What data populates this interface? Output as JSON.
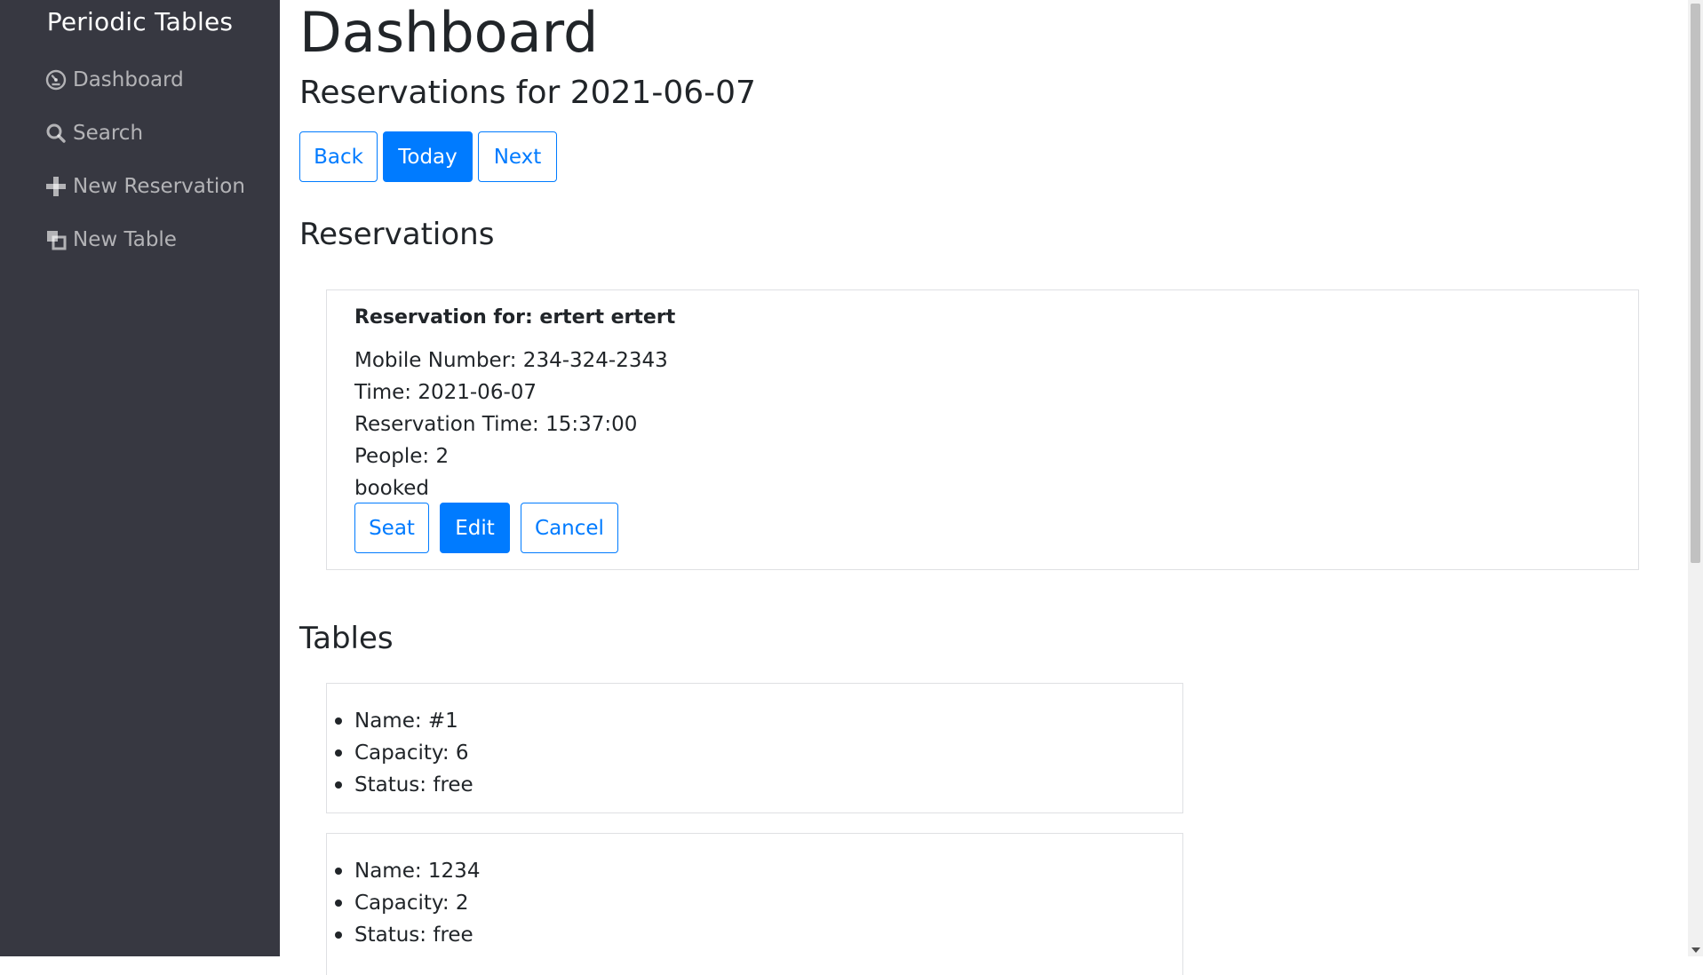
{
  "sidebar": {
    "brand": "Periodic Tables",
    "items": [
      {
        "label": "Dashboard",
        "icon": "dashboard-icon"
      },
      {
        "label": "Search",
        "icon": "search-icon"
      },
      {
        "label": "New Reservation",
        "icon": "plus-icon"
      },
      {
        "label": "New Table",
        "icon": "layers-icon"
      }
    ]
  },
  "main": {
    "title": "Dashboard",
    "subtitle": "Reservations for 2021-06-07",
    "date_nav": {
      "back": "Back",
      "today": "Today",
      "next": "Next"
    },
    "reservations_heading": "Reservations",
    "reservations": [
      {
        "name": "Reservation for: ertert ertert",
        "mobile": "Mobile Number: 234-324-2343",
        "time": "Time: 2021-06-07",
        "reservation_time": "Reservation Time: 15:37:00",
        "people": "People: 2",
        "status": "booked",
        "actions": {
          "seat": "Seat",
          "edit": "Edit",
          "cancel": "Cancel"
        }
      }
    ],
    "tables_heading": "Tables",
    "tables": [
      {
        "name": "Name: #1",
        "capacity": "Capacity: 6",
        "status": "Status: free"
      },
      {
        "name": "Name: 1234",
        "capacity": "Capacity: 2",
        "status": "Status: free"
      }
    ]
  },
  "colors": {
    "sidebar_bg": "#373841",
    "primary": "#007bff",
    "text": "#212529",
    "card_border": "#dfe0e3"
  }
}
